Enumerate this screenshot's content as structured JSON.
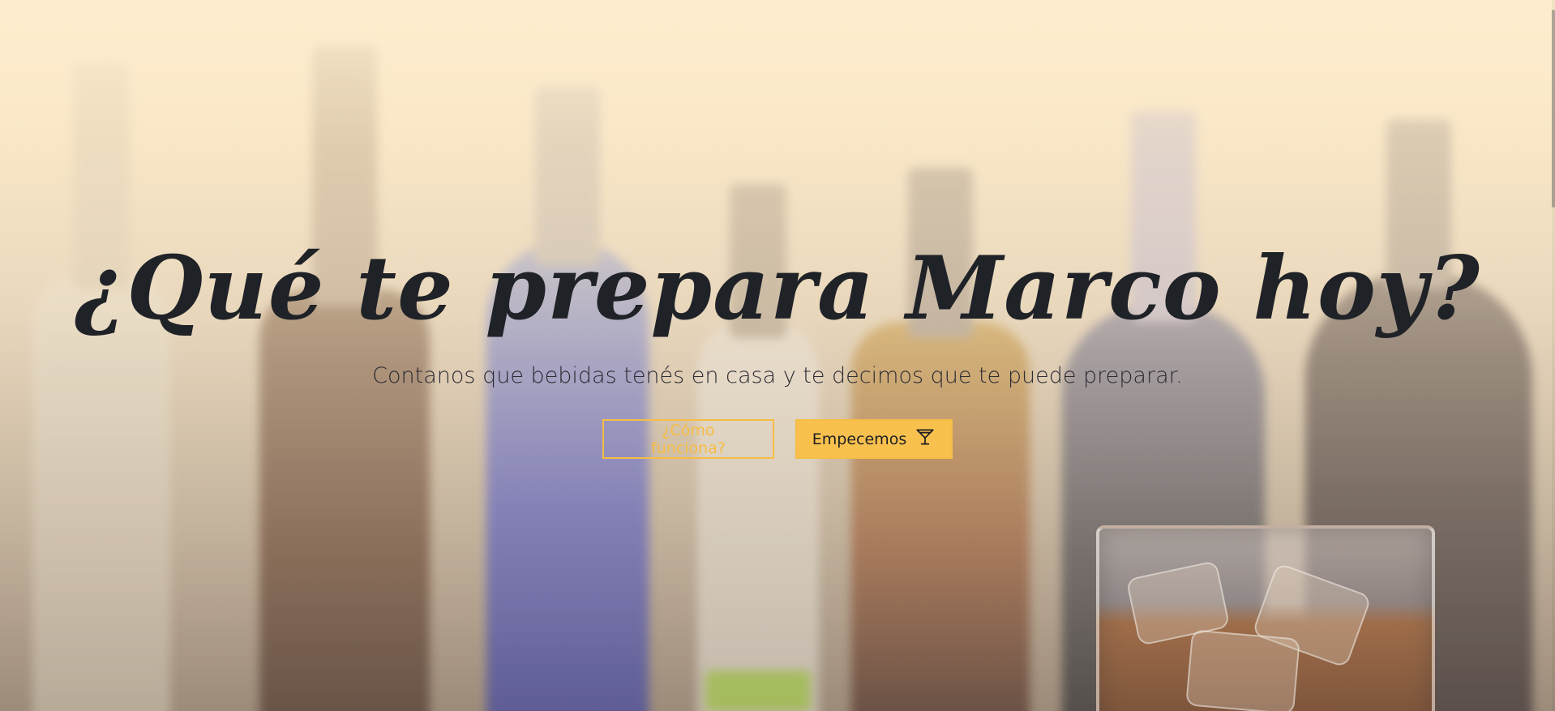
{
  "hero": {
    "title": "¿Qué te prepara Marco hoy?",
    "subtitle": "Contanos que bebidas tenés en casa y te decimos que te puede preparar.",
    "buttons": {
      "how_it_works_label": "¿Cómo funciona?",
      "start_label": "Empecemos",
      "start_icon": "cocktail-glass-icon"
    }
  },
  "colors": {
    "accent": "#f8c14e",
    "title_text": "#1f2227",
    "background_top": "#fdeccd"
  }
}
